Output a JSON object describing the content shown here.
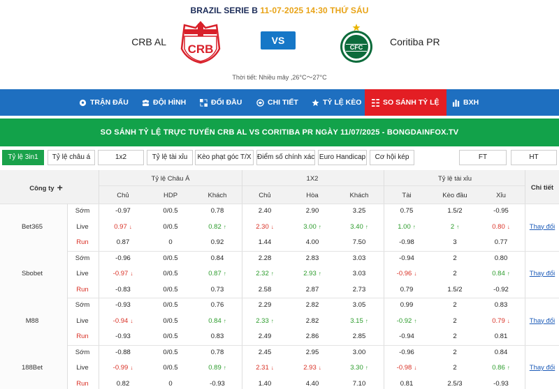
{
  "match": {
    "league": "BRAZIL SERIE B",
    "datetime": "11-07-2025 14:30 THỨ SÁU",
    "home": "CRB AL",
    "away": "Coritiba PR",
    "vs": "VS",
    "home_logo_text": "CRB",
    "away_logo_text": "CFC",
    "weather": "Thời tiết: Nhiều mây ,26°C～27°C"
  },
  "nav": [
    {
      "label": "TRẬN ĐẤU",
      "icon": "soccer-ball-icon"
    },
    {
      "label": "ĐỘI HÌNH",
      "icon": "team-icon"
    },
    {
      "label": "ĐỐI ĐẦU",
      "icon": "versus-icon"
    },
    {
      "label": "CHI TIẾT",
      "icon": "details-icon"
    },
    {
      "label": "TỶ LỆ KÈO",
      "icon": "star-icon"
    },
    {
      "label": "SO SÁNH TỶ LỆ",
      "icon": "compare-icon"
    },
    {
      "label": "BXH",
      "icon": "bar-chart-icon"
    }
  ],
  "banner": "SO SÁNH TỶ LỆ TRỰC TUYẾN CRB AL VS CORITIBA PR NGÀY 11/07/2025 - BONGDAINFOX.TV",
  "tabs": [
    "Tỷ lệ 3in1",
    "Tỷ lệ châu á",
    "1x2",
    "Tỷ lệ tài xỉu",
    "Kèo phạt góc T/X",
    "Điểm số chính xác",
    "Euro Handicap",
    "Cơ hội kép",
    "FT",
    "HT"
  ],
  "table": {
    "company_header": "Công ty",
    "group_headers": [
      "Tỷ lệ Châu Á",
      "1X2",
      "Tỷ lệ tài xỉu",
      "Chi tiết"
    ],
    "sub_headers": [
      "Chủ",
      "HDP",
      "Khách",
      "Chủ",
      "Hòa",
      "Khách",
      "Tài",
      "Kèo đầu",
      "Xỉu"
    ],
    "detail_link": "Thay đổi",
    "companies": [
      {
        "name": "Bet365",
        "rows": [
          {
            "label": "Sớm",
            "vals": [
              "-0.97",
              "0/0.5",
              "0.78",
              "2.40",
              "2.90",
              "3.25",
              "0.75",
              "1.5/2",
              "-0.95"
            ],
            "dir": [
              "",
              "",
              "",
              "",
              "",
              "",
              "",
              "",
              ""
            ]
          },
          {
            "label": "Live",
            "vals": [
              "0.97",
              "0/0.5",
              "0.82",
              "2.30",
              "3.00",
              "3.40",
              "1.00",
              "2",
              "0.80"
            ],
            "dir": [
              "down",
              "",
              "up",
              "down",
              "up",
              "up",
              "up",
              "up",
              "down"
            ]
          },
          {
            "label": "Run",
            "vals": [
              "0.87",
              "0",
              "0.92",
              "1.44",
              "4.00",
              "7.50",
              "-0.98",
              "3",
              "0.77"
            ],
            "dir": [
              "",
              "",
              "",
              "",
              "",
              "",
              "",
              "",
              ""
            ]
          }
        ]
      },
      {
        "name": "Sbobet",
        "rows": [
          {
            "label": "Sớm",
            "vals": [
              "-0.96",
              "0/0.5",
              "0.84",
              "2.28",
              "2.83",
              "3.03",
              "-0.94",
              "2",
              "0.80"
            ],
            "dir": [
              "",
              "",
              "",
              "",
              "",
              "",
              "",
              "",
              ""
            ]
          },
          {
            "label": "Live",
            "vals": [
              "-0.97",
              "0/0.5",
              "0.87",
              "2.32",
              "2.93",
              "3.03",
              "-0.96",
              "2",
              "0.84"
            ],
            "dir": [
              "down",
              "",
              "up",
              "up",
              "up",
              "",
              "down",
              "",
              "up"
            ]
          },
          {
            "label": "Run",
            "vals": [
              "-0.83",
              "0/0.5",
              "0.73",
              "2.58",
              "2.87",
              "2.73",
              "0.79",
              "1.5/2",
              "-0.92"
            ],
            "dir": [
              "",
              "",
              "",
              "",
              "",
              "",
              "",
              "",
              ""
            ]
          }
        ]
      },
      {
        "name": "M88",
        "rows": [
          {
            "label": "Sớm",
            "vals": [
              "-0.93",
              "0/0.5",
              "0.76",
              "2.29",
              "2.82",
              "3.05",
              "0.99",
              "2",
              "0.83"
            ],
            "dir": [
              "",
              "",
              "",
              "",
              "",
              "",
              "",
              "",
              ""
            ]
          },
          {
            "label": "Live",
            "vals": [
              "-0.94",
              "0/0.5",
              "0.84",
              "2.33",
              "2.82",
              "3.15",
              "-0.92",
              "2",
              "0.79"
            ],
            "dir": [
              "down",
              "",
              "up",
              "up",
              "",
              "up",
              "up",
              "",
              "down"
            ]
          },
          {
            "label": "Run",
            "vals": [
              "-0.93",
              "0/0.5",
              "0.83",
              "2.49",
              "2.86",
              "2.85",
              "-0.94",
              "2",
              "0.81"
            ],
            "dir": [
              "",
              "",
              "",
              "",
              "",
              "",
              "",
              "",
              ""
            ]
          }
        ]
      },
      {
        "name": "188Bet",
        "rows": [
          {
            "label": "Sớm",
            "vals": [
              "-0.88",
              "0/0.5",
              "0.78",
              "2.45",
              "2.95",
              "3.00",
              "-0.96",
              "2",
              "0.84"
            ],
            "dir": [
              "",
              "",
              "",
              "",
              "",
              "",
              "",
              "",
              ""
            ]
          },
          {
            "label": "Live",
            "vals": [
              "-0.99",
              "0/0.5",
              "0.89",
              "2.31",
              "2.93",
              "3.30",
              "-0.98",
              "2",
              "0.86"
            ],
            "dir": [
              "down",
              "",
              "up",
              "down",
              "down",
              "up",
              "down",
              "",
              "up"
            ]
          },
          {
            "label": "Run",
            "vals": [
              "0.82",
              "0",
              "-0.93",
              "1.40",
              "4.40",
              "7.10",
              "0.81",
              "2.5/3",
              "-0.93"
            ],
            "dir": [
              "",
              "",
              "",
              "",
              "",
              "",
              "",
              "",
              ""
            ]
          }
        ]
      }
    ]
  },
  "colors": {
    "nav_blue": "#1e6fc0",
    "active_red": "#e31e24",
    "banner_green": "#12a24a",
    "vs_blue": "#1677c7",
    "league_orange": "#e8a317",
    "up_green": "#2a9b2a",
    "down_red": "#d93025"
  }
}
